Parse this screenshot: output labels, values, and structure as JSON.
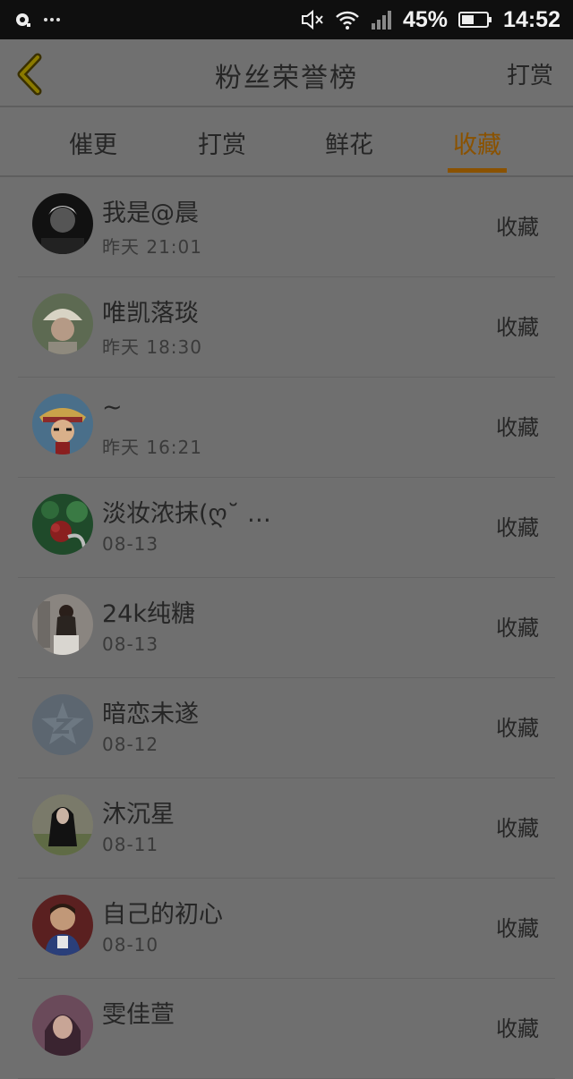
{
  "status_bar": {
    "left_icons": [
      "notification-icon",
      "more-dots-icon"
    ],
    "right_icons": [
      "muted-speaker-icon",
      "wifi-icon",
      "cellular-signal-icon",
      "battery-icon"
    ],
    "battery": "45%",
    "time": "14:52"
  },
  "header": {
    "title": "粉丝荣誉榜",
    "action": "打赏",
    "back_icon": "back-chevron-icon",
    "accent_color": "#8a5200"
  },
  "tabs": [
    {
      "label": "催更",
      "active": false
    },
    {
      "label": "打赏",
      "active": false
    },
    {
      "label": "鲜花",
      "active": false
    },
    {
      "label": "收藏",
      "active": true
    }
  ],
  "fans": [
    {
      "name": "我是@晨",
      "time": "昨天 21:01",
      "action": "收藏"
    },
    {
      "name": "唯凯落琰",
      "time": "昨天 18:30",
      "action": "收藏"
    },
    {
      "name": "~",
      "time": "昨天 16:21",
      "action": "收藏"
    },
    {
      "name": "淡妆浓抹(ღ˘ …",
      "time": "08-13",
      "action": "收藏"
    },
    {
      "name": "24k纯糖",
      "time": "08-13",
      "action": "收藏"
    },
    {
      "name": "暗恋未遂",
      "time": "08-12",
      "action": "收藏"
    },
    {
      "name": "沐沉星",
      "time": "08-11",
      "action": "收藏"
    },
    {
      "name": "自己的初心",
      "time": "08-10",
      "action": "收藏"
    },
    {
      "name": "雯佳萱",
      "time": "",
      "action": "收藏"
    }
  ]
}
